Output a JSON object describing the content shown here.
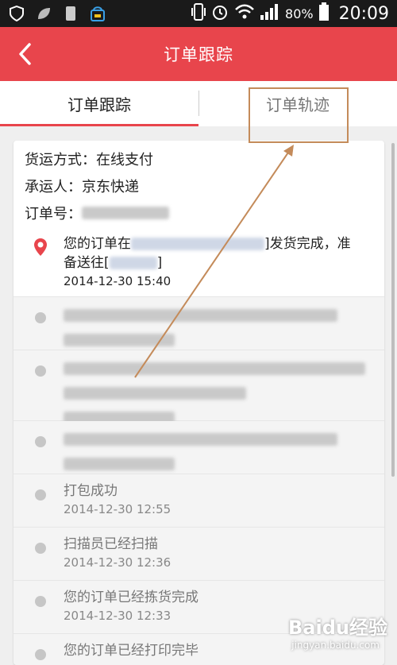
{
  "status_bar": {
    "battery": "80%",
    "time": "20:09",
    "icons": [
      "shield-icon",
      "leaf-icon",
      "phone-icon",
      "bag-icon",
      "vibrate-icon",
      "alarm-icon",
      "wifi-icon",
      "signal-icon",
      "battery-icon"
    ]
  },
  "header": {
    "title": "订单跟踪",
    "back_icon": "chevron-left-icon"
  },
  "tabs": [
    {
      "label": "订单跟踪",
      "active": true
    },
    {
      "label": "订单轨迹",
      "active": false
    }
  ],
  "order_info": {
    "shipping_method": "货运方式：在线支付",
    "carrier": "承运人：京东快递",
    "order_no_label": "订单号："
  },
  "timeline": [
    {
      "text_prefix": "您的订单在",
      "text_middle": "]发货完成，准",
      "text_line2_prefix": "备送往[",
      "text_line2_suffix": "]",
      "time": "2014-12-30  15:40",
      "current": true
    },
    {
      "text": "",
      "time": "",
      "blurred": true
    },
    {
      "text": "",
      "time": "",
      "blurred": true
    },
    {
      "text": "",
      "time": "",
      "blurred": true
    },
    {
      "text": "打包成功",
      "time": "2014-12-30  12:55"
    },
    {
      "text": "扫描员已经扫描",
      "time": "2014-12-30  12:36"
    },
    {
      "text": "您的订单已经拣货完成",
      "time": "2014-12-30  12:33"
    },
    {
      "text": "您的订单已经打印完毕",
      "time": ""
    }
  ],
  "watermark": {
    "brand": "Baidu经验",
    "url": "jingyan.baidu.com"
  },
  "colors": {
    "accent": "#e8454c",
    "annotation": "#c48b5a"
  }
}
